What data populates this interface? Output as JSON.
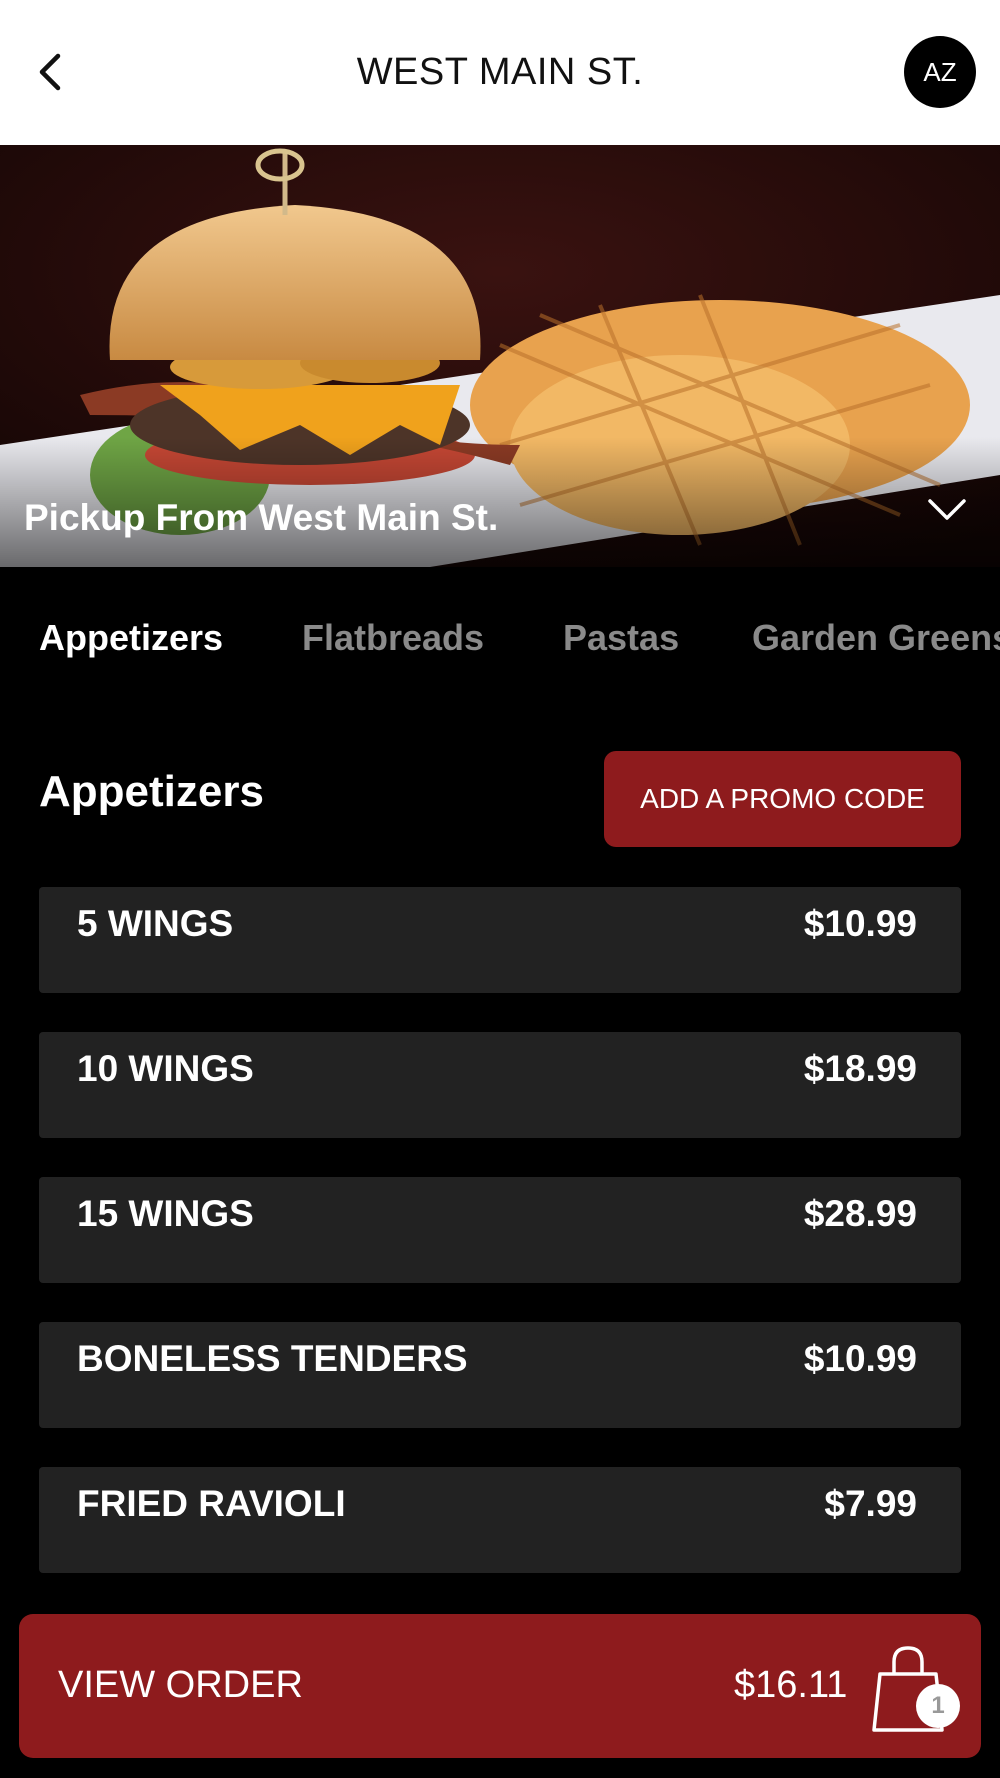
{
  "header": {
    "title": "WEST MAIN ST.",
    "avatar_initials": "AZ"
  },
  "hero": {
    "pickup_label": "Pickup From West Main St."
  },
  "tabs": [
    {
      "label": "Appetizers",
      "active": true
    },
    {
      "label": "Flatbreads",
      "active": false
    },
    {
      "label": "Pastas",
      "active": false
    },
    {
      "label": "Garden Greens",
      "active": false
    }
  ],
  "section": {
    "title": "Appetizers",
    "promo_label": "ADD A PROMO CODE"
  },
  "menu_items": [
    {
      "name": "5 WINGS",
      "price": "$10.99"
    },
    {
      "name": "10 WINGS",
      "price": "$18.99"
    },
    {
      "name": "15 WINGS",
      "price": "$28.99"
    },
    {
      "name": "BONELESS TENDERS",
      "price": "$10.99"
    },
    {
      "name": "FRIED RAVIOLI",
      "price": "$7.99"
    }
  ],
  "order_bar": {
    "label": "VIEW ORDER",
    "total": "$16.11",
    "item_count": "1"
  },
  "colors": {
    "accent": "#8e1b1d",
    "background": "#000000",
    "card": "#222222"
  }
}
